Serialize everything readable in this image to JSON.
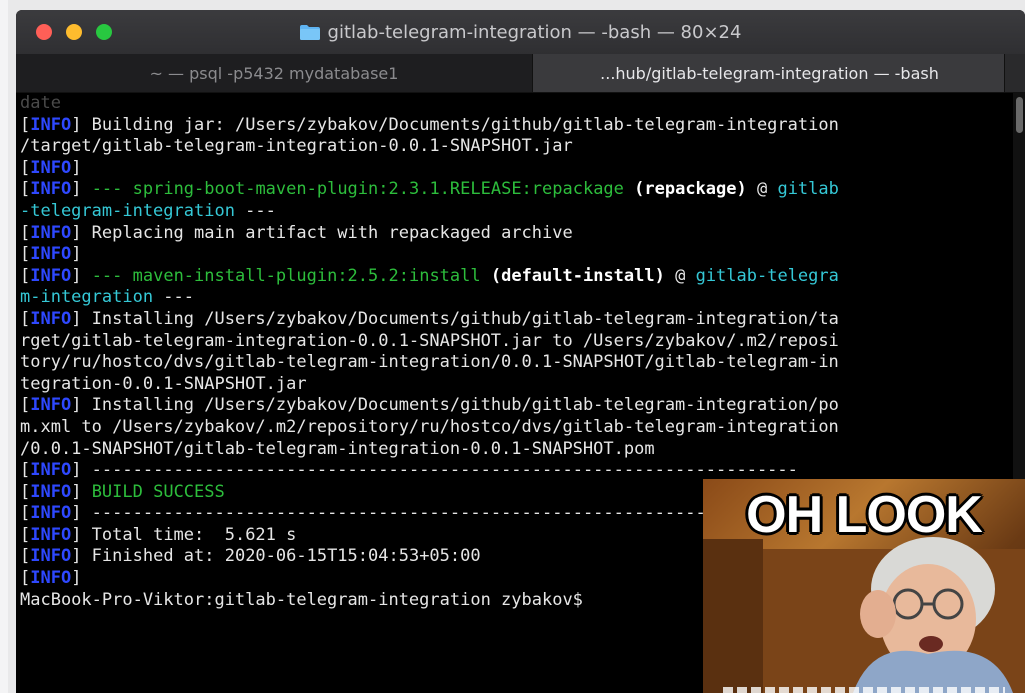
{
  "window": {
    "title": "gitlab-telegram-integration — -bash — 80×24"
  },
  "tabs": [
    {
      "label": "~ — psql -p5432 mydatabase1"
    },
    {
      "label": "...hub/gitlab-telegram-integration — -bash"
    }
  ],
  "terminal": {
    "lines": [
      [
        {
          "t": "date ",
          "k": "ghost"
        }
      ],
      [
        {
          "t": "[",
          "k": ""
        },
        {
          "t": "INFO",
          "k": "tag"
        },
        {
          "t": "] Building jar: /Users/zybakov/Documents/github/gitlab-telegram-integration",
          "k": ""
        }
      ],
      [
        {
          "t": "/target/gitlab-telegram-integration-0.0.1-SNAPSHOT.jar",
          "k": ""
        }
      ],
      [
        {
          "t": "[",
          "k": ""
        },
        {
          "t": "INFO",
          "k": "tag"
        },
        {
          "t": "]",
          "k": ""
        }
      ],
      [
        {
          "t": "[",
          "k": ""
        },
        {
          "t": "INFO",
          "k": "tag"
        },
        {
          "t": "] ",
          "k": ""
        },
        {
          "t": "--- spring-boot-maven-plugin:2.3.1.RELEASE:repackage",
          "k": "g"
        },
        {
          "t": " (repackage)",
          "k": "w"
        },
        {
          "t": " @ ",
          "k": ""
        },
        {
          "t": "gitlab",
          "k": "c"
        }
      ],
      [
        {
          "t": "-telegram-integration",
          "k": "c"
        },
        {
          "t": " ---",
          "k": ""
        }
      ],
      [
        {
          "t": "[",
          "k": ""
        },
        {
          "t": "INFO",
          "k": "tag"
        },
        {
          "t": "] Replacing main artifact with repackaged archive",
          "k": ""
        }
      ],
      [
        {
          "t": "[",
          "k": ""
        },
        {
          "t": "INFO",
          "k": "tag"
        },
        {
          "t": "]",
          "k": ""
        }
      ],
      [
        {
          "t": "[",
          "k": ""
        },
        {
          "t": "INFO",
          "k": "tag"
        },
        {
          "t": "] ",
          "k": ""
        },
        {
          "t": "--- maven-install-plugin:2.5.2:install",
          "k": "g"
        },
        {
          "t": " (default-install)",
          "k": "w"
        },
        {
          "t": " @ ",
          "k": ""
        },
        {
          "t": "gitlab-telegra",
          "k": "c"
        }
      ],
      [
        {
          "t": "m-integration",
          "k": "c"
        },
        {
          "t": " ---",
          "k": ""
        }
      ],
      [
        {
          "t": "[",
          "k": ""
        },
        {
          "t": "INFO",
          "k": "tag"
        },
        {
          "t": "] Installing /Users/zybakov/Documents/github/gitlab-telegram-integration/ta",
          "k": ""
        }
      ],
      [
        {
          "t": "rget/gitlab-telegram-integration-0.0.1-SNAPSHOT.jar to /Users/zybakov/.m2/reposi",
          "k": ""
        }
      ],
      [
        {
          "t": "tory/ru/hostco/dvs/gitlab-telegram-integration/0.0.1-SNAPSHOT/gitlab-telegram-in",
          "k": ""
        }
      ],
      [
        {
          "t": "tegration-0.0.1-SNAPSHOT.jar",
          "k": ""
        }
      ],
      [
        {
          "t": "[",
          "k": ""
        },
        {
          "t": "INFO",
          "k": "tag"
        },
        {
          "t": "] Installing /Users/zybakov/Documents/github/gitlab-telegram-integration/po",
          "k": ""
        }
      ],
      [
        {
          "t": "m.xml to /Users/zybakov/.m2/repository/ru/hostco/dvs/gitlab-telegram-integration",
          "k": ""
        }
      ],
      [
        {
          "t": "/0.0.1-SNAPSHOT/gitlab-telegram-integration-0.0.1-SNAPSHOT.pom",
          "k": ""
        }
      ],
      [
        {
          "t": "[",
          "k": ""
        },
        {
          "t": "INFO",
          "k": "tag"
        },
        {
          "t": "] ---------------------------------------------------------------------",
          "k": ""
        }
      ],
      [
        {
          "t": "[",
          "k": ""
        },
        {
          "t": "INFO",
          "k": "tag"
        },
        {
          "t": "] ",
          "k": ""
        },
        {
          "t": "BUILD SUCCESS",
          "k": "g"
        }
      ],
      [
        {
          "t": "[",
          "k": ""
        },
        {
          "t": "INFO",
          "k": "tag"
        },
        {
          "t": "] ---------------------------------------------------------------------",
          "k": ""
        }
      ],
      [
        {
          "t": "[",
          "k": ""
        },
        {
          "t": "INFO",
          "k": "tag"
        },
        {
          "t": "] Total time:  5.621 s",
          "k": ""
        }
      ],
      [
        {
          "t": "[",
          "k": ""
        },
        {
          "t": "INFO",
          "k": "tag"
        },
        {
          "t": "] Finished at: 2020-06-15T15:04:53+05:00",
          "k": ""
        }
      ],
      [
        {
          "t": "[",
          "k": ""
        },
        {
          "t": "INFO",
          "k": "tag"
        },
        {
          "t": "]",
          "k": ""
        }
      ],
      [
        {
          "t": "MacBook-Pro-Viktor:gitlab-telegram-integration zybakov$ ",
          "k": ""
        }
      ]
    ]
  },
  "meme": {
    "caption": "OH LOOK"
  },
  "colors": {
    "info_tag": "#2e48ff",
    "plugin_green": "#2dbd3c",
    "artifact_cyan": "#35c8d6"
  }
}
